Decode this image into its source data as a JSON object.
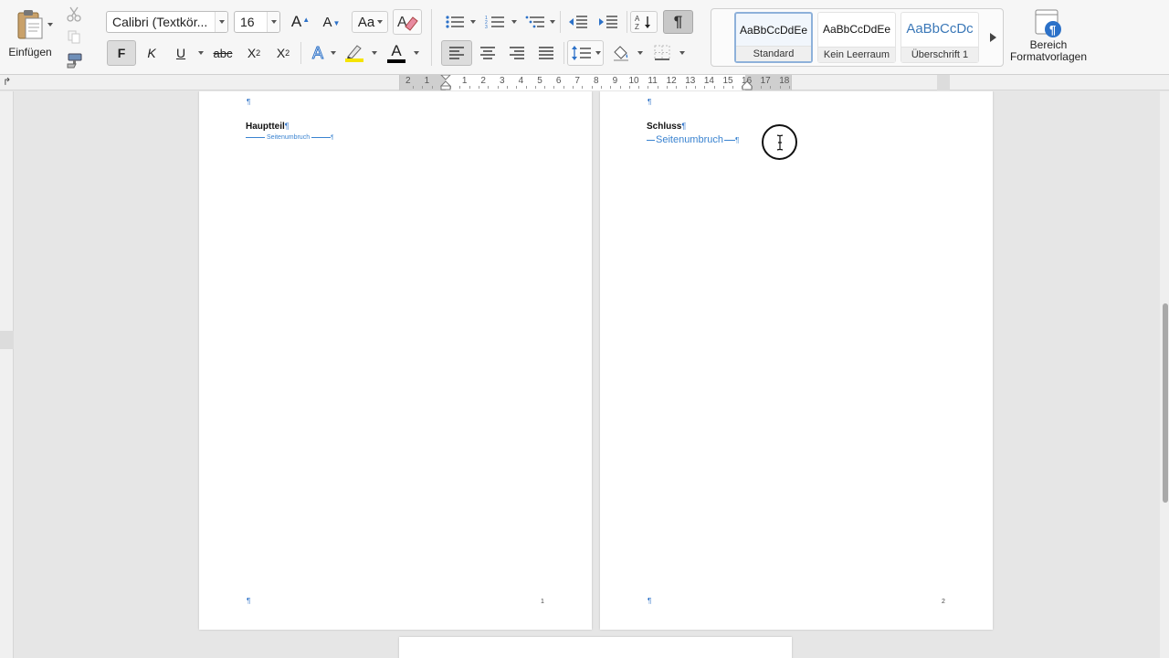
{
  "clipboard": {
    "paste_label": "Einfügen"
  },
  "font": {
    "family": "Calibri (Textkör...",
    "size": "16",
    "bold_label": "F",
    "italic_label": "K",
    "underline_label": "U",
    "strike_label": "abc",
    "subscript_label": "X",
    "subscript_mark": "2",
    "superscript_label": "X",
    "superscript_mark": "2",
    "grow_label": "A",
    "shrink_label": "A",
    "case_label": "Aa",
    "effects_label": "A",
    "color_label": "A"
  },
  "paragraph": {
    "show_marks_label": "¶"
  },
  "styles": {
    "items": [
      {
        "sample": "AaBbCcDdEe",
        "name": "Standard"
      },
      {
        "sample": "AaBbCcDdEe",
        "name": "Kein Leerraum"
      },
      {
        "sample": "AaBbCcDc",
        "name": "Überschrift 1"
      }
    ],
    "pane_label_1": "Bereich",
    "pane_label_2": "Formatvorlagen"
  },
  "ruler": {
    "labels": [
      "2",
      "1",
      "1",
      "2",
      "3",
      "4",
      "5",
      "6",
      "7",
      "8",
      "9",
      "10",
      "11",
      "12",
      "13",
      "14",
      "15",
      "16",
      "17",
      "18"
    ]
  },
  "pages": [
    {
      "heading": "Hauptteil",
      "pilcrow": "¶",
      "page_break_label": "Seitenumbruch",
      "page_number": "1"
    },
    {
      "heading": "Schluss",
      "pilcrow": "¶",
      "page_break_label": "Seitenumbruch",
      "page_number": "2"
    }
  ],
  "colors": {
    "accent_blue": "#2c71c8",
    "highlight_yellow": "#f5e400",
    "font_color_bar": "#000000"
  }
}
